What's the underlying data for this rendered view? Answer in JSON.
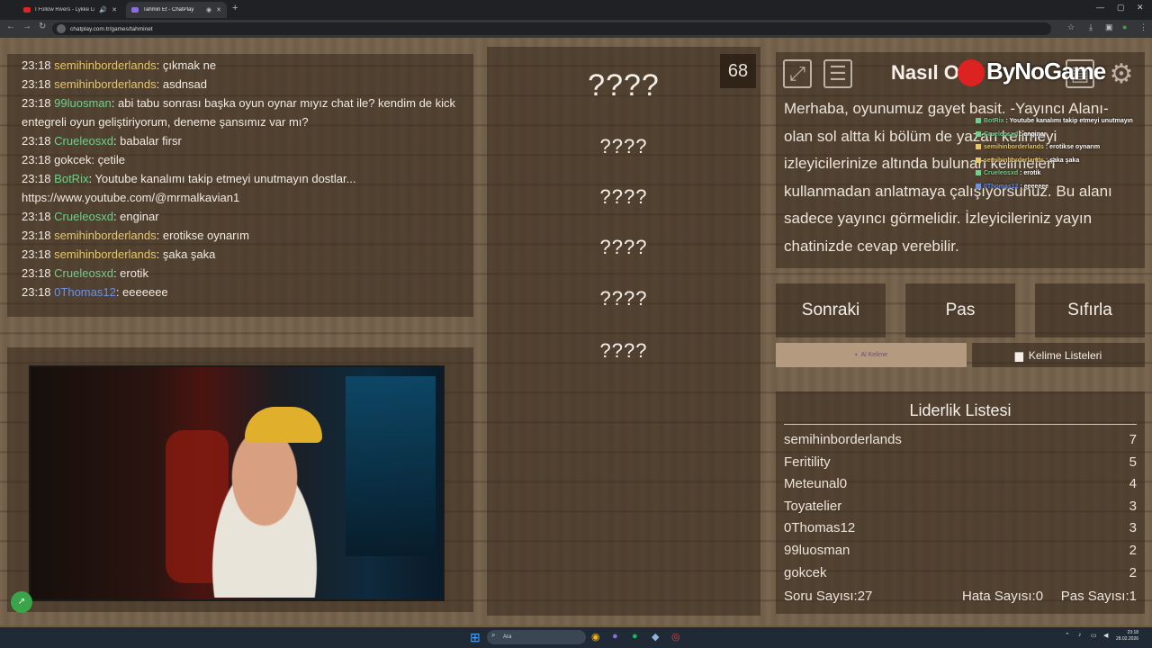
{
  "browser": {
    "tabs": [
      {
        "title": "I Follow Rivers - Lykke Li (l...",
        "active": false
      },
      {
        "title": "Tahmin Et - ChatPlay",
        "active": true
      }
    ],
    "url": "chatplay.com.tr/games/tahminet"
  },
  "chat": {
    "messages": [
      {
        "time": "23:18",
        "user": "semihinborderlands",
        "color": "#e6c66a",
        "text": ": çıkmak ne"
      },
      {
        "time": "23:18",
        "user": "semihinborderlands",
        "color": "#e6c66a",
        "text": ": asdnsad"
      },
      {
        "time": "23:18",
        "user": "99luosman",
        "color": "#6ed08a",
        "text": ": abi tabu sonrası başka oyun oynar mıyız chat ile? kendim de kick entegreli oyun geliştiriyorum, deneme şansımız var mı?"
      },
      {
        "time": "23:18",
        "user": "Crueleosxd",
        "color": "#6ed08a",
        "text": ": babalar firsr"
      },
      {
        "time": "23:18",
        "user": "gokcek",
        "color": "#f1ebe3",
        "text": ": çetile"
      },
      {
        "time": "23:18",
        "user": "BotRix",
        "color": "#6ed08a",
        "text": ": Youtube kanalımı takip etmeyi unutmayın dostlar... https://www.youtube.com/@mrmalkavian1"
      },
      {
        "time": "23:18",
        "user": "Crueleosxd",
        "color": "#6ed08a",
        "text": ": enginar"
      },
      {
        "time": "23:18",
        "user": "semihinborderlands",
        "color": "#e6c66a",
        "text": ": erotikse oynarım"
      },
      {
        "time": "23:18",
        "user": "semihinborderlands",
        "color": "#e6c66a",
        "text": ": şaka şaka"
      },
      {
        "time": "23:18",
        "user": "Crueleosxd",
        "color": "#6ed08a",
        "text": ": erotik"
      },
      {
        "time": "23:18",
        "user": "0Thomas12",
        "color": "#6b90e8",
        "text": ": eeeeeee"
      }
    ]
  },
  "game": {
    "timer": "68",
    "slots": [
      "????",
      "????",
      "????",
      "????",
      "????",
      "????"
    ],
    "info_title": "Nasıl O",
    "info_text": "Merhaba, oyunumuz gayet basit. -Yayıncı Alanı- olan sol altta ki bölüm de yazan kelimeyi izleyicilerinize altında bulunan kelimeleri kullanmadan anlatmaya çalışıyorsunuz. Bu alanı sadece yayıncı görmelidir. İzleyicileriniz yayın chatinizde cevap verebilir.",
    "buttons": {
      "next": "Sonraki",
      "pass": "Pas",
      "reset": "Sıfırla"
    },
    "tabs": {
      "get_word": "Al Kelime",
      "word_lists": "Kelime Listeleri"
    }
  },
  "stream_overlay": {
    "brand": "ByNoGame",
    "lines": [
      {
        "user": "BotRix",
        "text": " : Youtube kanalımı takip etmeyi unutmayın",
        "color": "#6ed08a"
      },
      {
        "user": "Crueleosxd",
        "text": " : enginar",
        "color": "#6ed08a"
      },
      {
        "user": "semihinborderlands",
        "text": " : erotikse oynarım",
        "color": "#e6c66a"
      },
      {
        "user": "semihinborderlands",
        "text": " : şaka şaka",
        "color": "#e6c66a"
      },
      {
        "user": "Crueleosxd",
        "text": " : erotik",
        "color": "#6ed08a"
      },
      {
        "user": "0Thomas12",
        "text": " : eeeeeee",
        "color": "#6b90e8"
      }
    ]
  },
  "leaderboard": {
    "title": "Liderlik Listesi",
    "rows": [
      {
        "name": "semihinborderlands",
        "score": "7"
      },
      {
        "name": "Feritility",
        "score": "5"
      },
      {
        "name": "Meteunal0",
        "score": "4"
      },
      {
        "name": "Toyatelier",
        "score": "3"
      },
      {
        "name": "0Thomas12",
        "score": "3"
      },
      {
        "name": "99luosman",
        "score": "2"
      },
      {
        "name": "gokcek",
        "score": "2"
      }
    ],
    "stats": {
      "questions": "Soru Sayısı:27",
      "errors": "Hata Sayısı:0",
      "passes": "Pas Sayısı:1"
    }
  },
  "taskbar": {
    "search_placeholder": "Ara",
    "time": "23:18",
    "date": "28.02.2026"
  },
  "icons": {
    "fullscreen": "fullscreen-icon",
    "notes": "notes-icon",
    "settings": "gear-icon",
    "windows": "windows-icon"
  }
}
